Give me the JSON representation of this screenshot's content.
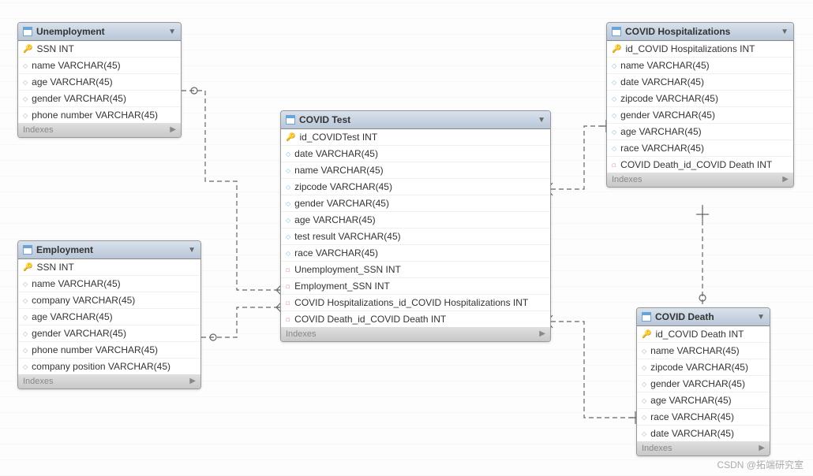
{
  "diagram": {
    "watermark": "CSDN @拓端研究室",
    "indexes_label": "Indexes"
  },
  "tables": {
    "unemployment": {
      "title": "Unemployment",
      "cols": [
        {
          "icon": "key",
          "label": "SSN INT"
        },
        {
          "icon": "col",
          "label": "name VARCHAR(45)"
        },
        {
          "icon": "col",
          "label": "age VARCHAR(45)"
        },
        {
          "icon": "col",
          "label": "gender VARCHAR(45)"
        },
        {
          "icon": "col",
          "label": "phone number VARCHAR(45)"
        }
      ]
    },
    "employment": {
      "title": "Employment",
      "cols": [
        {
          "icon": "key",
          "label": "SSN INT"
        },
        {
          "icon": "col",
          "label": "name VARCHAR(45)"
        },
        {
          "icon": "col",
          "label": "company VARCHAR(45)"
        },
        {
          "icon": "col",
          "label": "age VARCHAR(45)"
        },
        {
          "icon": "col",
          "label": "gender VARCHAR(45)"
        },
        {
          "icon": "col",
          "label": "phone number VARCHAR(45)"
        },
        {
          "icon": "col",
          "label": "company position VARCHAR(45)"
        }
      ]
    },
    "covid_test": {
      "title": "COVID Test",
      "cols": [
        {
          "icon": "key",
          "label": "id_COVIDTest INT"
        },
        {
          "icon": "col",
          "label": "date VARCHAR(45)"
        },
        {
          "icon": "col",
          "label": "name VARCHAR(45)"
        },
        {
          "icon": "col",
          "label": "zipcode VARCHAR(45)"
        },
        {
          "icon": "col",
          "label": "gender VARCHAR(45)"
        },
        {
          "icon": "col",
          "label": "age VARCHAR(45)"
        },
        {
          "icon": "col",
          "label": "test result VARCHAR(45)"
        },
        {
          "icon": "col",
          "label": "race VARCHAR(45)"
        },
        {
          "icon": "fk",
          "label": "Unemployment_SSN INT"
        },
        {
          "icon": "fk",
          "label": "Employment_SSN INT"
        },
        {
          "icon": "fk",
          "label": "COVID Hospitalizations_id_COVID Hospitalizations INT"
        },
        {
          "icon": "fk",
          "label": "COVID Death_id_COVID Death INT"
        }
      ]
    },
    "covid_hosp": {
      "title": "COVID Hospitalizations",
      "cols": [
        {
          "icon": "key",
          "label": "id_COVID Hospitalizations INT"
        },
        {
          "icon": "col",
          "label": "name VARCHAR(45)"
        },
        {
          "icon": "col",
          "label": "date VARCHAR(45)"
        },
        {
          "icon": "col",
          "label": "zipcode VARCHAR(45)"
        },
        {
          "icon": "col",
          "label": "gender VARCHAR(45)"
        },
        {
          "icon": "col",
          "label": "age VARCHAR(45)"
        },
        {
          "icon": "col",
          "label": "race VARCHAR(45)"
        },
        {
          "icon": "fk",
          "label": "COVID Death_id_COVID Death INT"
        }
      ]
    },
    "covid_death": {
      "title": "COVID Death",
      "cols": [
        {
          "icon": "key",
          "label": "id_COVID Death INT"
        },
        {
          "icon": "col",
          "label": "name VARCHAR(45)"
        },
        {
          "icon": "col",
          "label": "zipcode VARCHAR(45)"
        },
        {
          "icon": "col",
          "label": "gender VARCHAR(45)"
        },
        {
          "icon": "col",
          "label": "age VARCHAR(45)"
        },
        {
          "icon": "col",
          "label": "race VARCHAR(45)"
        },
        {
          "icon": "col",
          "label": "date VARCHAR(45)"
        }
      ]
    }
  },
  "chart_data": {
    "type": "diagram",
    "entities": [
      {
        "name": "Unemployment",
        "pk": "SSN"
      },
      {
        "name": "Employment",
        "pk": "SSN"
      },
      {
        "name": "COVID Test",
        "pk": "id_COVIDTest"
      },
      {
        "name": "COVID Hospitalizations",
        "pk": "id_COVID Hospitalizations"
      },
      {
        "name": "COVID Death",
        "pk": "id_COVID Death"
      }
    ],
    "relationships": [
      {
        "from": "COVID Test",
        "to": "Unemployment",
        "via": "Unemployment_SSN",
        "type": "many-to-one"
      },
      {
        "from": "COVID Test",
        "to": "Employment",
        "via": "Employment_SSN",
        "type": "many-to-one"
      },
      {
        "from": "COVID Test",
        "to": "COVID Hospitalizations",
        "via": "COVID Hospitalizations_id_COVID Hospitalizations",
        "type": "many-to-one"
      },
      {
        "from": "COVID Test",
        "to": "COVID Death",
        "via": "COVID Death_id_COVID Death",
        "type": "many-to-one"
      },
      {
        "from": "COVID Hospitalizations",
        "to": "COVID Death",
        "via": "COVID Death_id_COVID Death",
        "type": "many-to-one"
      }
    ]
  }
}
